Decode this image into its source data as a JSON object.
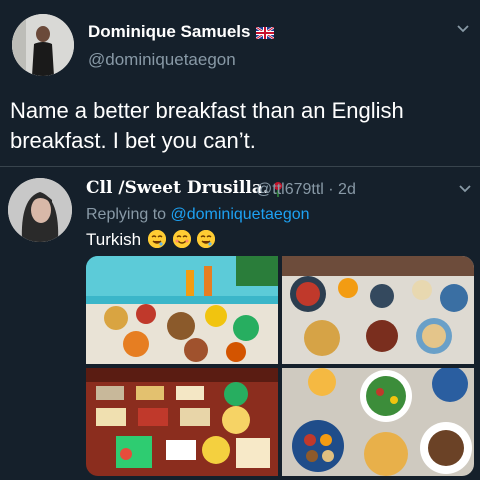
{
  "original_tweet": {
    "author_name": "Dominique Samuels",
    "author_handle": "@dominiquetaegon",
    "flag_icon": "uk-flag-icon",
    "text": "Name a better breakfast than an English breakfast. I bet you can’t."
  },
  "reply_tweet": {
    "author_name": "Cll /Sweet Drusilla.",
    "author_handle": "@ttl679ttl · 2d",
    "replying_prefix": "Replying to",
    "replying_to": "@dominiquetaegon",
    "text": "Turkish",
    "emoji_icons": [
      "drooling-face-icon",
      "smiling-face-icon",
      "drooling-face-icon"
    ],
    "photos": [
      "turkish-breakfast-poolside-photo",
      "turkish-breakfast-spread-photo",
      "turkish-breakfast-table-photo",
      "turkish-breakfast-plates-photo"
    ]
  },
  "colors": {
    "background": "#15202b",
    "text_primary": "#ffffff",
    "text_secondary": "#8899a6",
    "link": "#1da1f2",
    "divider": "#38444d"
  }
}
